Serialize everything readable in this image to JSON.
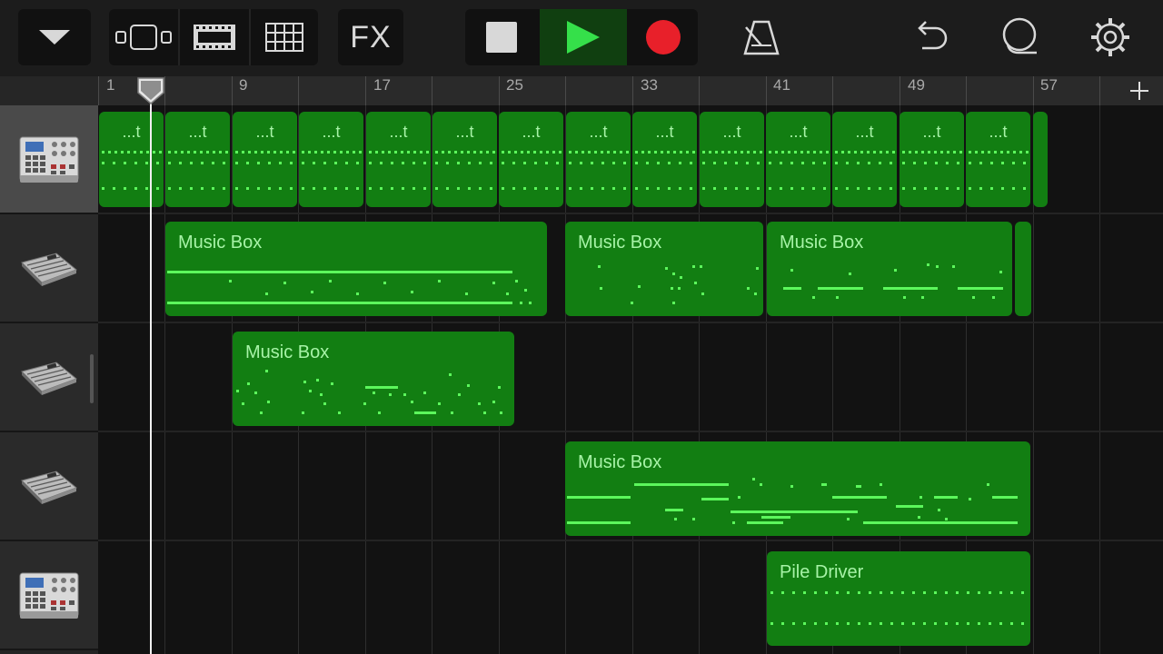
{
  "toolbar": {
    "buttons": [
      {
        "name": "browser-menu-button",
        "icon": "triangle-down-icon"
      },
      {
        "name": "tracks-view-button",
        "icon": "track-view-icon"
      },
      {
        "name": "loop-browser-button",
        "icon": "film-strip-icon"
      },
      {
        "name": "live-loops-button",
        "icon": "grid-icon"
      },
      {
        "name": "fx-button",
        "label": "FX"
      },
      {
        "name": "stop-button",
        "icon": "stop-square-icon"
      },
      {
        "name": "play-button",
        "icon": "play-triangle-icon"
      },
      {
        "name": "record-button",
        "icon": "record-dot-icon"
      },
      {
        "name": "metronome-button",
        "icon": "metronome-icon"
      },
      {
        "name": "undo-button",
        "icon": "undo-arrow-icon"
      },
      {
        "name": "master-volume-button",
        "icon": "lasso-icon"
      },
      {
        "name": "settings-button",
        "icon": "gear-icon"
      }
    ],
    "fx_label": "FX",
    "colors": {
      "play_active": "#35e04a",
      "record": "#e8202a",
      "icon": "#d8d8d8"
    }
  },
  "ruler": {
    "labels": [
      "1",
      "9",
      "17",
      "25",
      "33",
      "41",
      "49",
      "57"
    ],
    "add_icon": "plus-icon"
  },
  "tracks": [
    {
      "instrument": "drum-machine-icon",
      "selected": true
    },
    {
      "instrument": "keyboard-icon",
      "selected": false
    },
    {
      "instrument": "keyboard-icon",
      "selected": false
    },
    {
      "instrument": "keyboard-icon",
      "selected": false
    },
    {
      "instrument": "drum-machine-icon",
      "selected": false
    }
  ],
  "regions": {
    "track1_label": "...t",
    "track1_count": 14,
    "music_box": "Music Box",
    "pile_driver": "Pile Driver"
  },
  "colors": {
    "region_fill": "#127e12",
    "region_text": "#a7f3a7",
    "note": "#5cf75c",
    "playhead": "#f0f0f0"
  }
}
